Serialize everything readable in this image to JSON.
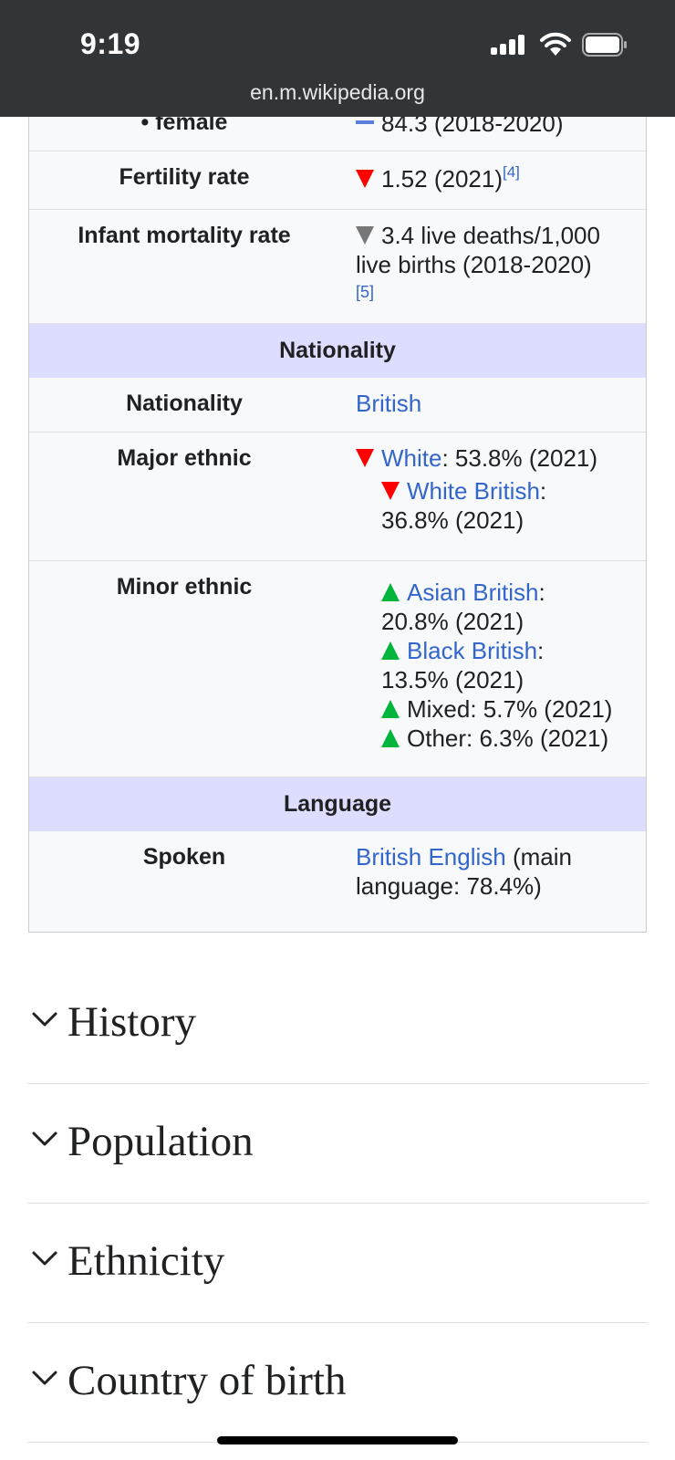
{
  "status_bar": {
    "time": "9:19",
    "url": "en.m.wikipedia.org"
  },
  "infobox": {
    "female_row": {
      "label": "• female",
      "trend": "flat",
      "value": "84.3 (2018-2020)"
    },
    "fertility_row": {
      "label": "Fertility rate",
      "trend": "down",
      "value": "1.52 (2021)",
      "ref": "[4]"
    },
    "infant_row": {
      "label": "Infant mortality rate",
      "trend": "down-grey",
      "value_line1": "3.4 live deaths/1,000",
      "value_line2": "live births (2018-2020)",
      "ref": "[5]"
    },
    "nationality_header": "Nationality",
    "nationality_row": {
      "label": "Nationality",
      "link": "British"
    },
    "major_ethnic_row": {
      "label": "Major ethnic",
      "items": [
        {
          "trend": "down",
          "link": "White",
          "rest": ": 53.8% (2021)"
        },
        {
          "trend": "down",
          "link": "White British",
          "rest": ":",
          "line2": "36.8% (2021)"
        }
      ]
    },
    "minor_ethnic_row": {
      "label": "Minor ethnic",
      "items": [
        {
          "trend": "up",
          "link": "Asian British",
          "rest": ":",
          "line2": "20.8% (2021)"
        },
        {
          "trend": "up",
          "link": "Black British",
          "rest": ":",
          "line2": "13.5% (2021)"
        },
        {
          "trend": "up",
          "text": "Mixed: 5.7% (2021)"
        },
        {
          "trend": "up",
          "text": "Other: 6.3% (2021)"
        }
      ]
    },
    "language_header": "Language",
    "spoken_row": {
      "label": "Spoken",
      "link": "British English",
      "rest_line1": " (main",
      "rest_line2": "language: 78.4%)"
    }
  },
  "sections": [
    {
      "title": "History"
    },
    {
      "title": "Population"
    },
    {
      "title": "Ethnicity"
    },
    {
      "title": "Country of birth"
    }
  ],
  "colors": {
    "topbar": "#323537",
    "header_band": "#ddddff",
    "link": "#3366cc",
    "trend_down": "#ff0000",
    "trend_up": "#00b43c",
    "trend_neutral": "#777777"
  }
}
